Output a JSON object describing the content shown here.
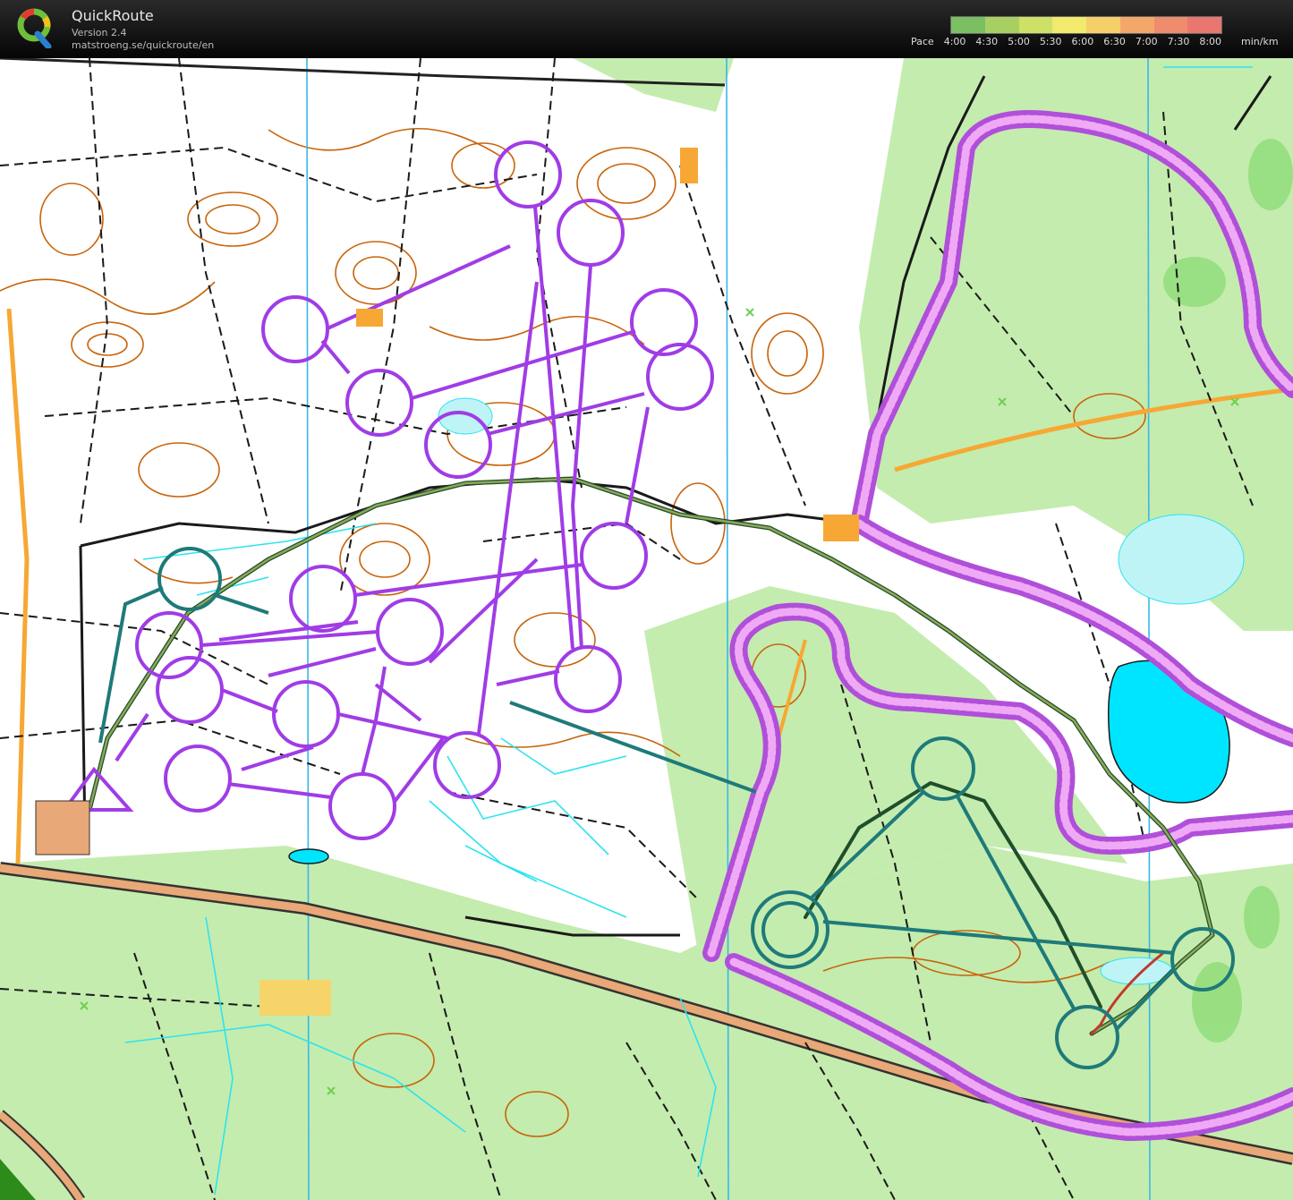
{
  "app": {
    "title": "QuickRoute",
    "version": "Version 2.4",
    "url": "matstroeng.se/quickroute/en",
    "logo_letter": "Q"
  },
  "pace_legend": {
    "label": "Pace",
    "ticks": [
      "4:00",
      "4:30",
      "5:00",
      "5:30",
      "6:00",
      "6:30",
      "7:00",
      "7:30",
      "8:00"
    ],
    "unit": "min/km",
    "gradient_colors": [
      "#7bbf63",
      "#a8cf62",
      "#cfe066",
      "#f2ea6c",
      "#f6cf6a",
      "#f3a86a",
      "#ee8c6d",
      "#ea7670"
    ]
  },
  "map": {
    "colors": {
      "open_land": "#ffffff",
      "forest_green": "#c4ecae",
      "dense_green": "#8fdc78",
      "contour": "#c8640a",
      "road_orange": "#f7a733",
      "path_black": "#1a1a1a",
      "water": "#00e5ff",
      "north_line": "#39b8e8",
      "course_purple": "#a03ce6",
      "course_teal": "#1f7a7a",
      "forbidden_magenta": "#b04fd9"
    },
    "icons": [
      "start-triangle-icon",
      "control-circle-icon",
      "gps-route-icon"
    ]
  }
}
